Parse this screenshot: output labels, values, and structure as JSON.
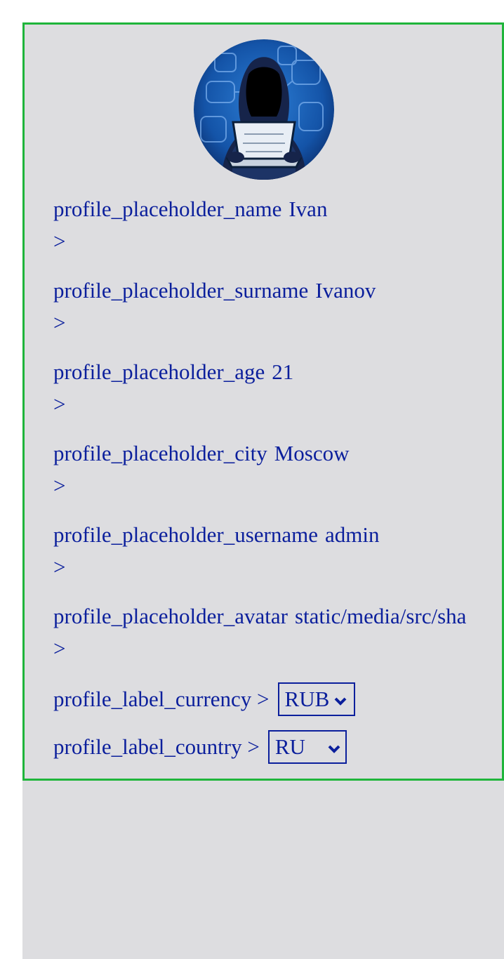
{
  "profile": {
    "fields": [
      {
        "label": "profile_placeholder_name",
        "value": "Ivan",
        "arrow": ">"
      },
      {
        "label": "profile_placeholder_surname",
        "value": "Ivanov",
        "arrow": ">"
      },
      {
        "label": "profile_placeholder_age",
        "value": "21",
        "arrow": ">"
      },
      {
        "label": "profile_placeholder_city",
        "value": "Moscow",
        "arrow": ">"
      },
      {
        "label": "profile_placeholder_username",
        "value": "admin",
        "arrow": ">"
      },
      {
        "label": "profile_placeholder_avatar",
        "value": "static/media/src/sha",
        "arrow": ">"
      }
    ],
    "currency": {
      "label": "profile_label_currency >",
      "selected": "RUB"
    },
    "country": {
      "label": "profile_label_country >",
      "selected": "RU"
    }
  },
  "colors": {
    "text": "#0b1f9c",
    "card_border": "#1fb53b",
    "card_bg": "#dddde0",
    "avatar_bg": "#1454a8"
  },
  "icons": {
    "avatar": "hooded-hacker-laptop-icon",
    "select_arrow": "chevron-down-icon"
  }
}
